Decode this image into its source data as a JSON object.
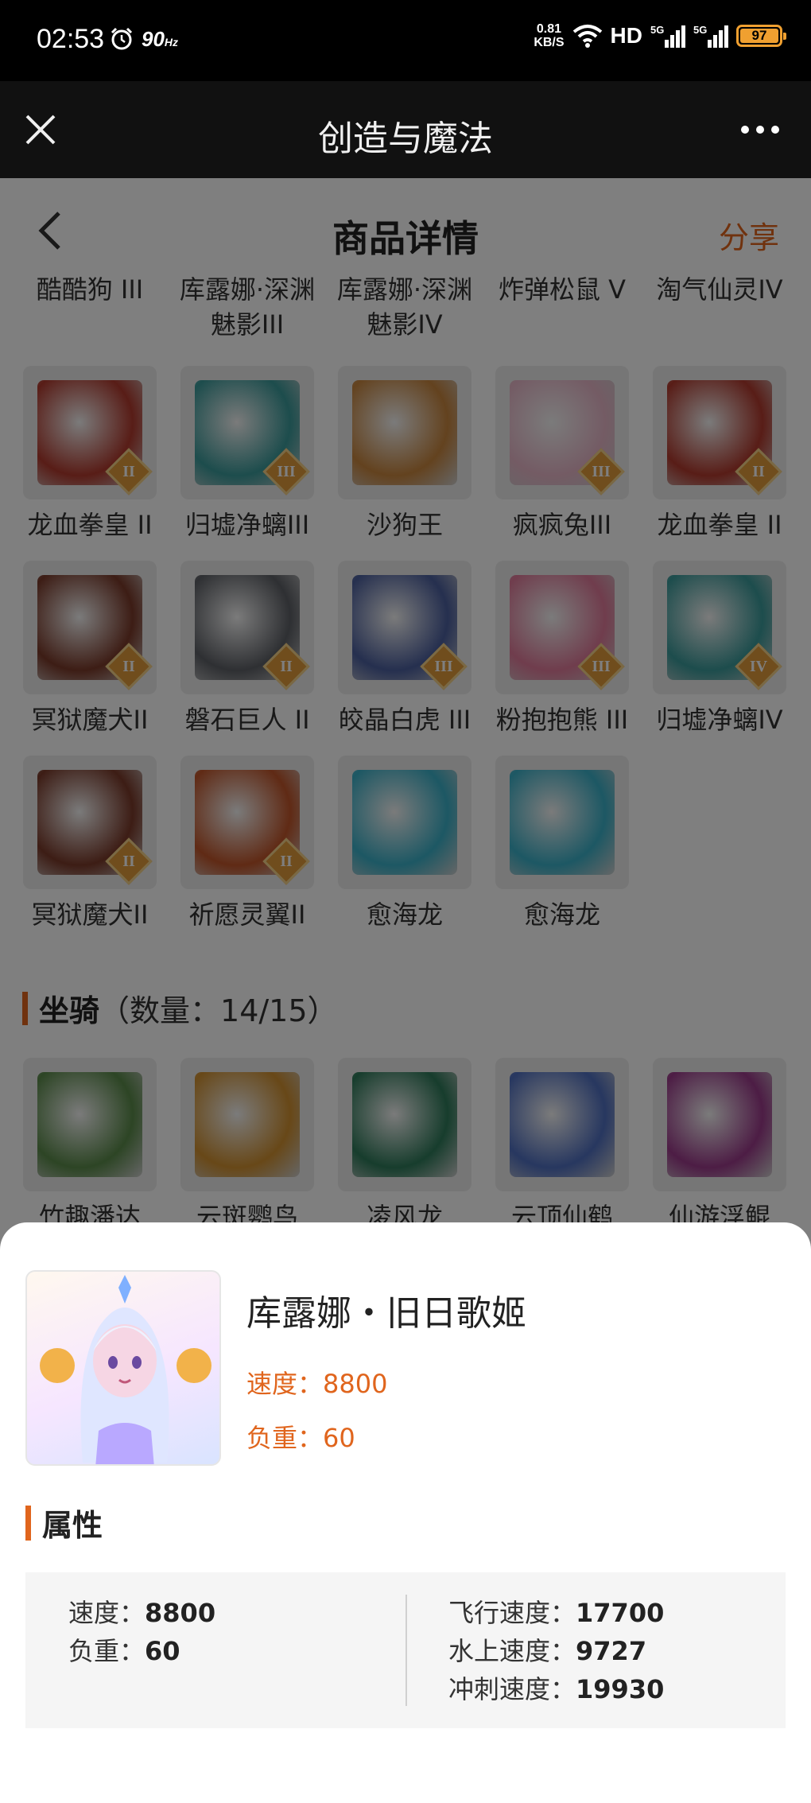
{
  "status_bar": {
    "time": "02:53",
    "refresh_rate": "90",
    "refresh_unit": "Hz",
    "net_speed_value": "0.81",
    "net_speed_unit": "KB/S",
    "hd_label": "HD",
    "signal1_label": "5G",
    "signal2_label": "5G",
    "battery": "97",
    "battery_color": "#f0a030"
  },
  "title_bar": {
    "title": "创造与魔法"
  },
  "page": {
    "title": "商品详情",
    "share": "分享",
    "accent_color": "#e0651d",
    "top_cut_row": [
      {
        "name": "酷酷狗 III"
      },
      {
        "name": "库露娜·深渊魅影III"
      },
      {
        "name": "库露娜·深渊魅影IV"
      },
      {
        "name": "炸弹松鼠 V"
      },
      {
        "name": "淘气仙灵IV"
      }
    ],
    "pet_rows": [
      [
        {
          "name": "龙血拳皇 II",
          "badge": "II",
          "color": "#b13a2e"
        },
        {
          "name": "归墟净螭III",
          "badge": "III",
          "color": "#3a9a9a"
        },
        {
          "name": "沙狗王",
          "badge": "",
          "color": "#c7853e"
        },
        {
          "name": "疯疯兔III",
          "badge": "III",
          "color": "#e8b7c9"
        },
        {
          "name": "龙血拳皇 II",
          "badge": "II",
          "color": "#b13a2e"
        }
      ],
      [
        {
          "name": "冥狱魔犬II",
          "badge": "II",
          "color": "#7a3a2a"
        },
        {
          "name": "磐石巨人 II",
          "badge": "II",
          "color": "#5d6066"
        },
        {
          "name": "皎晶白虎 III",
          "badge": "III",
          "color": "#4b5f9e"
        },
        {
          "name": "粉抱抱熊 III",
          "badge": "III",
          "color": "#e07a9a"
        },
        {
          "name": "归墟净螭IV",
          "badge": "IV",
          "color": "#3a9a9a"
        }
      ],
      [
        {
          "name": "冥狱魔犬II",
          "badge": "II",
          "color": "#7a3a2a"
        },
        {
          "name": "祈愿灵翼II",
          "badge": "II",
          "color": "#c0552a"
        },
        {
          "name": "愈海龙",
          "badge": "",
          "color": "#3ab0c8"
        },
        {
          "name": "愈海龙",
          "badge": "",
          "color": "#3ab0c8"
        }
      ]
    ],
    "mounts_section": {
      "label": "坐骑",
      "count": "（数量：14/15）"
    },
    "mount_row": [
      {
        "name": "竹趣潘达",
        "color": "#5a8a4a"
      },
      {
        "name": "云斑鹦鸟",
        "color": "#d09030"
      },
      {
        "name": "凌风龙",
        "color": "#2e7a5a"
      },
      {
        "name": "云顶仙鹤",
        "color": "#4f6fc0"
      },
      {
        "name": "仙游浮鲲",
        "color": "#9a3a8a"
      }
    ]
  },
  "sheet": {
    "item_name": "库露娜・旧日歌姬",
    "speed_line": "速度：8800",
    "load_line": "负重：60",
    "attr_label": "属性",
    "attrs_left": [
      {
        "label": "速度：",
        "value": "8800"
      },
      {
        "label": "负重：",
        "value": "60"
      }
    ],
    "attrs_right": [
      {
        "label": "飞行速度：",
        "value": "17700"
      },
      {
        "label": "水上速度：",
        "value": "9727"
      },
      {
        "label": "冲刺速度：",
        "value": "19930"
      }
    ]
  }
}
